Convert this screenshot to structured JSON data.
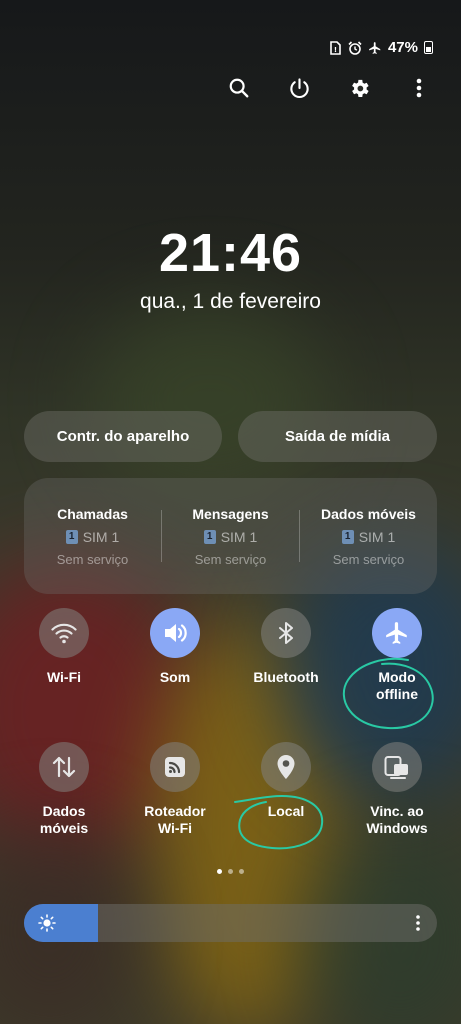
{
  "status_bar": {
    "icons": [
      "sim-icon",
      "alarm-icon",
      "airplane-icon"
    ],
    "battery": "47%"
  },
  "toolbar": {
    "icons": [
      "search-icon",
      "power-icon",
      "gear-icon",
      "more-vert-icon"
    ]
  },
  "clock": {
    "time": "21:46",
    "date": "qua., 1 de fevereiro"
  },
  "buttons": {
    "device_control": "Contr. do aparelho",
    "media_output": "Saída de mídia"
  },
  "sim_panel": [
    {
      "title": "Chamadas",
      "sim": "SIM 1",
      "sim_badge": "1",
      "status": "Sem serviço"
    },
    {
      "title": "Mensagens",
      "sim": "SIM 1",
      "sim_badge": "1",
      "status": "Sem serviço"
    },
    {
      "title": "Dados móveis",
      "sim": "SIM 1",
      "sim_badge": "1",
      "status": "Sem serviço"
    }
  ],
  "tiles_row1": [
    {
      "label": "Wi-Fi",
      "icon": "wifi-icon",
      "on": false
    },
    {
      "label": "Som",
      "icon": "sound-icon",
      "on": true
    },
    {
      "label": "Bluetooth",
      "icon": "bluetooth-icon",
      "on": false
    },
    {
      "label": "Modo\noffline",
      "icon": "airplane-icon",
      "on": true
    }
  ],
  "tiles_row2": [
    {
      "label": "Dados\nmóveis",
      "icon": "mobile-data-icon",
      "on": false
    },
    {
      "label": "Roteador\nWi-Fi",
      "icon": "hotspot-icon",
      "on": false
    },
    {
      "label": "Local",
      "icon": "location-icon",
      "on": false
    },
    {
      "label": "Vinc. ao\nWindows",
      "icon": "link-to-windows-icon",
      "on": false
    }
  ],
  "page_indicator": {
    "pages": 3,
    "current": 1
  },
  "brightness": {
    "level": 0.18,
    "icon": "sun-icon",
    "menu_icon": "more-vert-icon"
  },
  "colors": {
    "accent_on": "#8aa8f5",
    "brightness_fill": "#4b7fd0",
    "annotation": "#29c9a4"
  }
}
